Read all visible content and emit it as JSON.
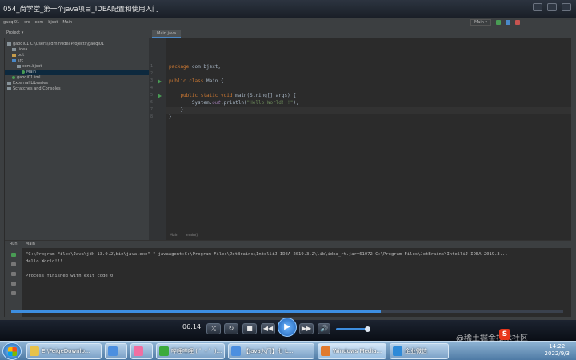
{
  "player": {
    "title": "054_尚学堂_第一个java项目_IDEA配置和使用入门",
    "time": "06:14",
    "progress": 0.67,
    "volume": 0.8
  },
  "ide": {
    "breadcrumb": [
      "gaoqi01",
      "src",
      "com",
      "bjsxt",
      "Main"
    ],
    "project_header": "Project ▾",
    "run_config": "Main ▾",
    "editor_tab": "Main.java",
    "tree": [
      {
        "label": "gaoqi01  C:\\Users\\admin\\IdeaProjects\\gaoqi01",
        "kind": "folder",
        "indent": 0
      },
      {
        "label": ".idea",
        "kind": "folder",
        "indent": 1
      },
      {
        "label": "out",
        "kind": "folder-o",
        "indent": 1
      },
      {
        "label": "src",
        "kind": "folder-b",
        "indent": 1
      },
      {
        "label": "com.bjsxt",
        "kind": "folder",
        "indent": 2
      },
      {
        "label": "Main",
        "kind": "class",
        "indent": 3,
        "selected": true
      },
      {
        "label": "gaoqi01.iml",
        "kind": "file",
        "indent": 1
      },
      {
        "label": "External Libraries",
        "kind": "folder",
        "indent": 0
      },
      {
        "label": "Scratches and Consoles",
        "kind": "folder",
        "indent": 0
      }
    ],
    "code": [
      {
        "n": "1",
        "parts": [
          {
            "c": "kw",
            "t": "package "
          },
          {
            "c": "pl",
            "t": "com.bjsxt;"
          }
        ]
      },
      {
        "n": "2",
        "parts": []
      },
      {
        "n": "3",
        "parts": [
          {
            "c": "kw",
            "t": "public class "
          },
          {
            "c": "pl",
            "t": "Main {"
          }
        ]
      },
      {
        "n": "4",
        "parts": []
      },
      {
        "n": "5",
        "parts": [
          {
            "c": "kw",
            "t": "    public static void "
          },
          {
            "c": "pl",
            "t": "main(String[] args) {"
          }
        ]
      },
      {
        "n": "6",
        "parts": [
          {
            "c": "pl",
            "t": "        System."
          },
          {
            "c": "it",
            "t": "out"
          },
          {
            "c": "pl",
            "t": ".println("
          },
          {
            "c": "str",
            "t": "\"Hello World!!!\""
          },
          {
            "c": "pl",
            "t": ");"
          }
        ]
      },
      {
        "n": "7",
        "parts": [
          {
            "c": "pl",
            "t": "    }"
          }
        ]
      },
      {
        "n": "8",
        "parts": [
          {
            "c": "pl",
            "t": "}"
          }
        ]
      }
    ],
    "editor_crumb": [
      "Main",
      "main()"
    ],
    "run": {
      "label": "Run:",
      "tab": "Main",
      "lines": [
        "\"C:\\Program Files\\Java\\jdk-13.0.2\\bin\\java.exe\" \"-javaagent:C:\\Program Files\\JetBrains\\IntelliJ IDEA 2019.3.2\\lib\\idea_rt.jar=61072:C:\\Program Files\\JetBrains\\IntelliJ IDEA 2019.3...",
        "Hello World!!!",
        "",
        "Process finished with exit code 0"
      ]
    }
  },
  "taskbar": {
    "items": [
      {
        "label": "E:\\FeigeDownlo...",
        "color": "#e8c24a"
      },
      {
        "label": "",
        "color": "#4c8fe0"
      },
      {
        "label": "",
        "color": "#f06fa2"
      },
      {
        "label": "哔哩哔哩 ( ゜- ゜)...",
        "color": "#3caa3c"
      },
      {
        "label": "【Java入门】七 L...",
        "color": "#4c8fe0"
      },
      {
        "label": "Windows Media...",
        "color": "#e07a2e"
      },
      {
        "label": "企业微信",
        "color": "#2e8ad8"
      }
    ],
    "time": "14:22",
    "date": "2022/9/3"
  },
  "watermark": "@稀土掘金技术社区",
  "ime_logo": "S"
}
